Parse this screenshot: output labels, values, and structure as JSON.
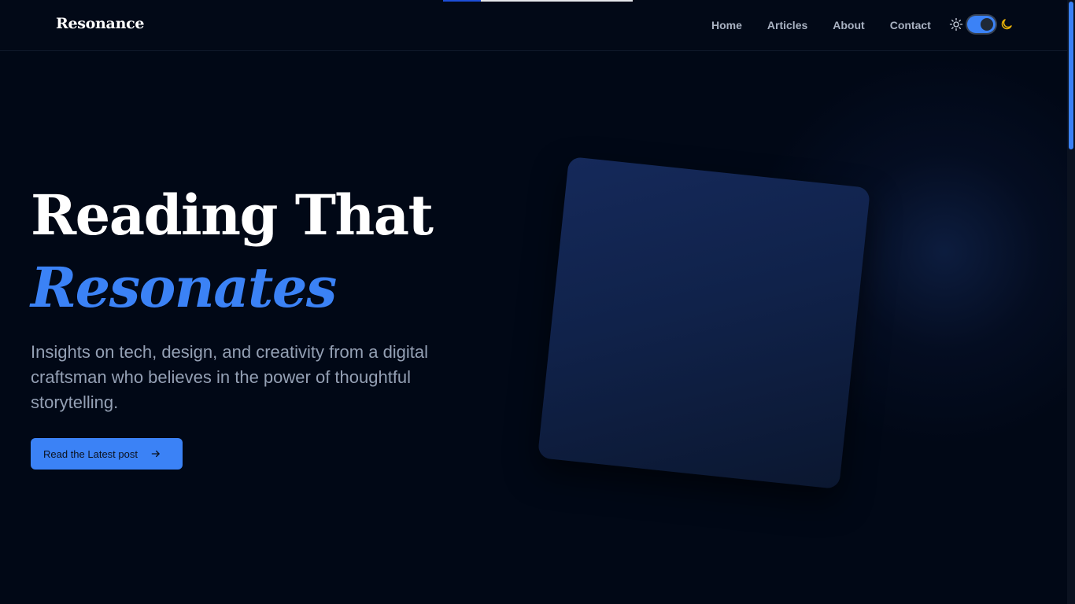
{
  "header": {
    "brand": "Resonance",
    "nav": [
      {
        "label": "Home"
      },
      {
        "label": "Articles"
      },
      {
        "label": "About"
      },
      {
        "label": "Contact"
      }
    ],
    "theme_toggle": {
      "state": "dark",
      "sun_icon": "sun-icon",
      "moon_icon": "moon-icon"
    }
  },
  "reading_progress": {
    "fraction": 0.2
  },
  "hero": {
    "title_line1": "Reading That",
    "title_line2": "Resonates",
    "subtitle": "Insights on tech, design, and creativity from a digital craftsman who believes in the power of thoughtful storytelling.",
    "cta_label": "Read the Latest post",
    "cta_icon": "arrow-right-icon"
  },
  "colors": {
    "background": "#010816",
    "accent": "#3b82f6",
    "text": "#ffffff",
    "muted_text": "#94a0b4",
    "moon": "#eab308"
  }
}
